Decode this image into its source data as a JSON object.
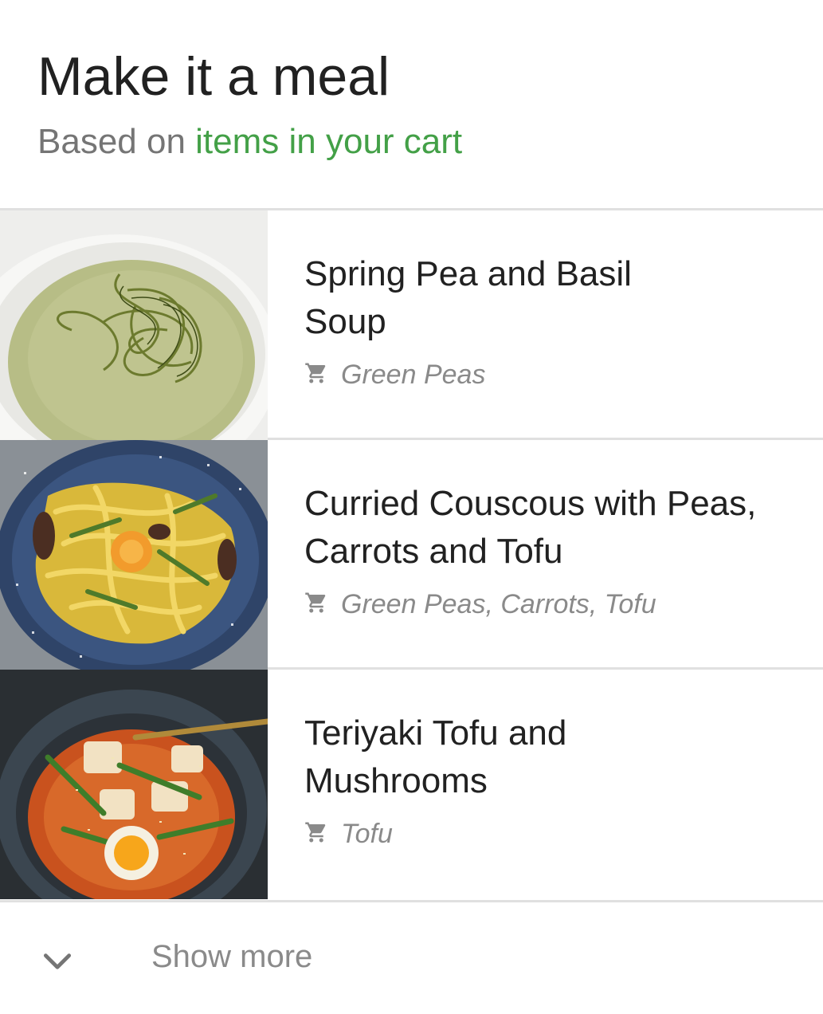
{
  "header": {
    "title": "Make it a meal",
    "subtitle_prefix": "Based on ",
    "subtitle_link": "items in your cart"
  },
  "recipes": [
    {
      "title": "Spring Pea and Basil Soup",
      "ingredients": "Green Peas",
      "image": "pea-soup-image",
      "icon": "cart-icon"
    },
    {
      "title": "Curried Couscous with Peas, Carrots and Tofu",
      "ingredients": "Green Peas, Carrots, Tofu",
      "image": "pasta-plate-image",
      "icon": "cart-icon"
    },
    {
      "title": "Teriyaki Tofu and Mushrooms",
      "ingredients": "Tofu",
      "image": "tofu-soup-bowl-image",
      "icon": "cart-icon"
    }
  ],
  "footer": {
    "show_more_label": "Show more",
    "icon": "chevron-down-icon"
  },
  "colors": {
    "accent": "#43a047",
    "title": "#212121",
    "secondary": "#757575",
    "divider": "#e0e0e0"
  }
}
